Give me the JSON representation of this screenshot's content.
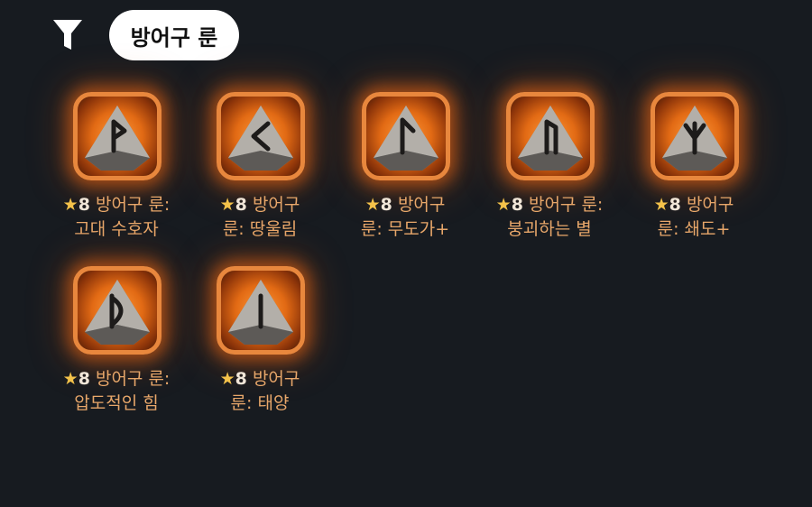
{
  "filter": {
    "icon": "filter-icon",
    "chip_label": "방어구 룬"
  },
  "colors": {
    "background": "#171b20",
    "slot_border": "#e8873d",
    "slot_glow": "#e26a14",
    "label_text": "#e8a76a",
    "star": "#f4c24a"
  },
  "items": [
    {
      "star": "★",
      "grade": "8",
      "line1": "방어구 룬:",
      "line2": "고대 수호자",
      "rune_icon": "rune-wunjo-icon"
    },
    {
      "star": "★",
      "grade": "8",
      "line1": "방어구",
      "line2": "룬: 땅울림",
      "rune_icon": "rune-kaunan-icon"
    },
    {
      "star": "★",
      "grade": "8",
      "line1": "방어구",
      "line2": "룬: 무도가+",
      "rune_icon": "rune-laguz-icon"
    },
    {
      "star": "★",
      "grade": "8",
      "line1": "방어구 룬:",
      "line2": "붕괴하는 별",
      "rune_icon": "rune-uruz-icon"
    },
    {
      "star": "★",
      "grade": "8",
      "line1": "방어구",
      "line2": "룬: 쇄도+",
      "rune_icon": "rune-algiz-icon"
    },
    {
      "star": "★",
      "grade": "8",
      "line1": "방어구 룬:",
      "line2": "압도적인 힘",
      "rune_icon": "rune-thurisaz-icon"
    },
    {
      "star": "★",
      "grade": "8",
      "line1": "방어구",
      "line2": "룬: 태양",
      "rune_icon": "rune-isa-icon"
    }
  ]
}
